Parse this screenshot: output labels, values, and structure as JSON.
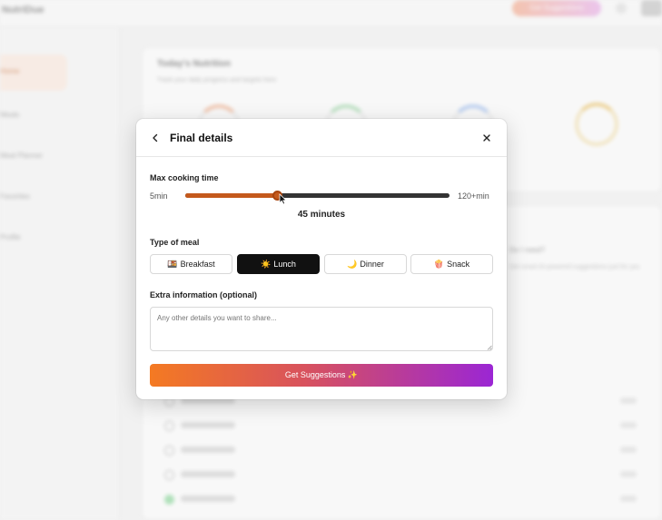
{
  "background": {
    "brand": "NutriDue",
    "top_button": "Get Suggestions",
    "sidebar": [
      "Home",
      "Meals",
      "Meal Planner",
      "Favorites",
      "Profile"
    ],
    "panel_title": "Today's Nutrition",
    "panel_subtitle": "Track your daily progress and targets here",
    "side_question": "Do I need?",
    "side_text": "Get smart AI-powered suggestions just for you"
  },
  "modal": {
    "title": "Final details",
    "cooking_label": "Max cooking time",
    "min_label": "5min",
    "max_label": "120+min",
    "slider_value": 45,
    "slider_min": 5,
    "slider_max": 120,
    "value_text": "45 minutes",
    "meal_label": "Type of meal",
    "meals": [
      {
        "icon": "🍱",
        "label": "Breakfast",
        "selected": false
      },
      {
        "icon": "☀️",
        "label": "Lunch",
        "selected": true
      },
      {
        "icon": "🌙",
        "label": "Dinner",
        "selected": false
      },
      {
        "icon": "🍿",
        "label": "Snack",
        "selected": false
      }
    ],
    "extra_label": "Extra information (optional)",
    "extra_placeholder": "Any other details you want to share...",
    "extra_value": "",
    "cta_label": "Get Suggestions ✨"
  },
  "colors": {
    "accent": "#c4591c",
    "selected_bg": "#111111",
    "cta_start": "#f47a22",
    "cta_end": "#9b26d4"
  }
}
